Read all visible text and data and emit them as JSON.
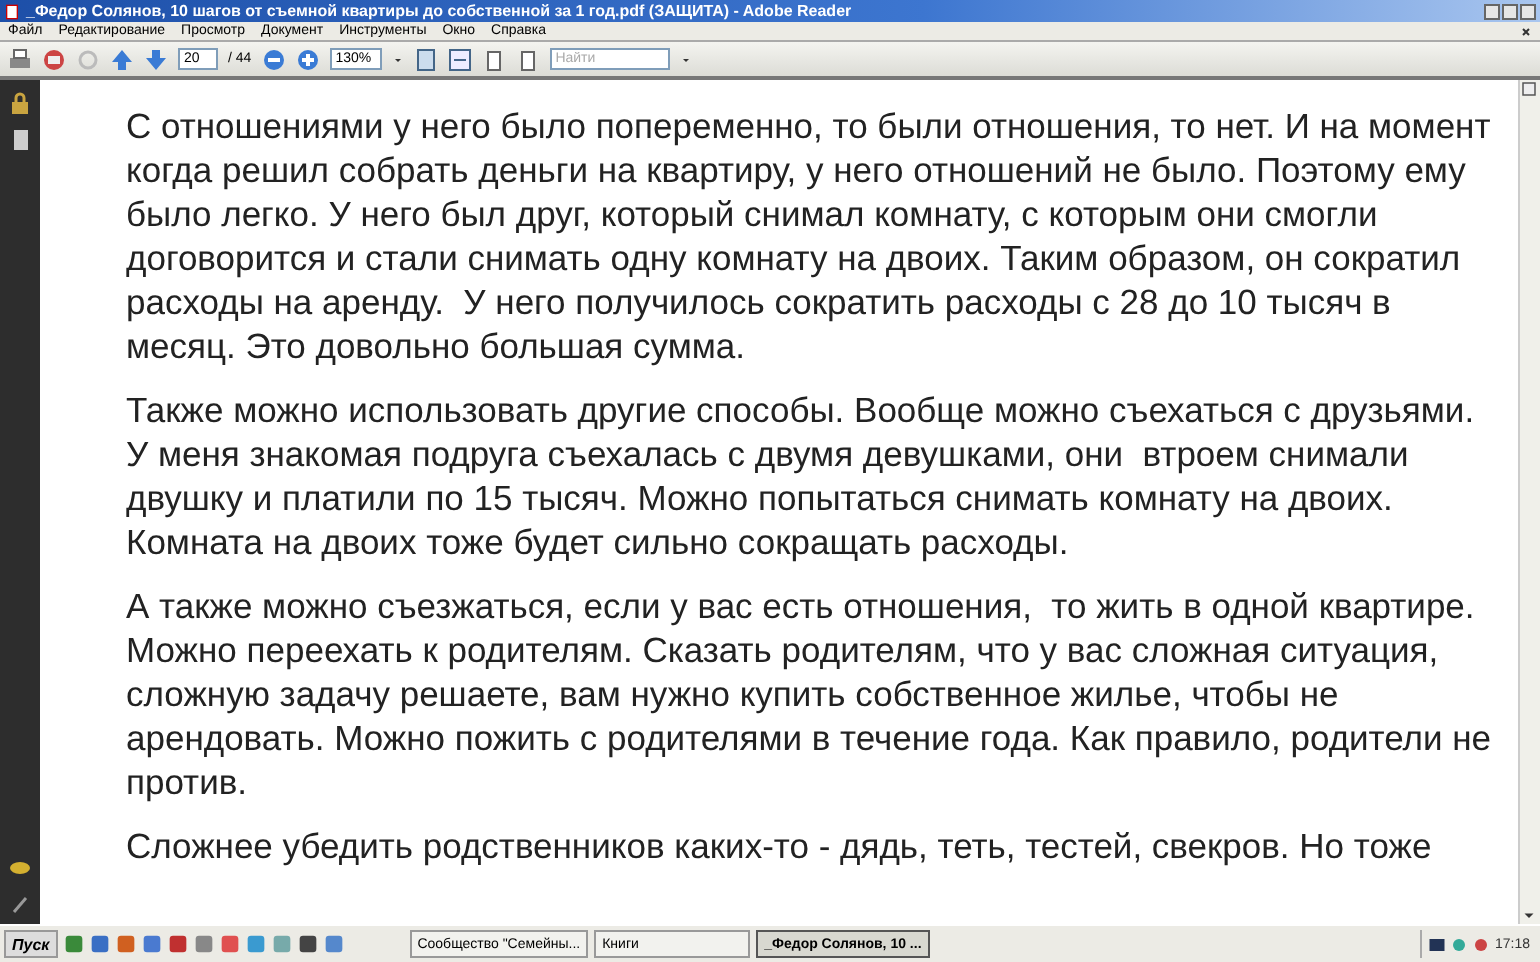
{
  "window": {
    "title": "_Федор Солянов, 10 шагов от съемной квартиры до  собственной за 1 год.pdf (ЗАЩИТА) - Adobe Reader"
  },
  "menu": [
    "Файл",
    "Редактирование",
    "Просмотр",
    "Документ",
    "Инструменты",
    "Окно",
    "Справка"
  ],
  "toolbar": {
    "page": "20",
    "page_count": "/ 44",
    "zoom": "130%",
    "search": {
      "placeholder": "Найти"
    }
  },
  "document": {
    "paragraphs": [
      "С отношениями у него было попеременно, то были отношения, то нет. И на момент\nкогда решил собрать деньги на квартиру, у него отношений не было. Поэтому ему\nбыло легко. У него был друг, который снимал комнату, с которым они смогли\nдоговорится и стали снимать одну комнату на двоих. Таким образом, он сократил\nрасходы на аренду.  У него получилось сократить расходы с 28 до 10 тысяч в\nмесяц. Это довольно большая сумма.",
      "Также можно использовать другие способы. Вообще можно съехаться с друзьями.\nУ меня знакомая подруга съехалась с двумя девушками, они  втроем снимали\nдвушку и платили по 15 тысяч. Можно попытаться снимать комнату на двоих.\nКомната на двоих тоже будет сильно сокращать расходы.",
      "А также можно съезжаться, если у вас есть отношения,  то жить в одной квартире.\nМожно переехать к родителям. Сказать родителям, что у вас сложная ситуация,\nсложную задачу решаете, вам нужно купить собственное жилье, чтобы не\nарендовать. Можно пожить с родителями в течение года. Как правило, родители не\nпротив.",
      "Сложнее убедить родственников каких-то - дядь, теть, тестей, свекров. Но тоже"
    ]
  },
  "taskbar": {
    "start": "Пуск",
    "windows": [
      {
        "label": "Сообщество \"Семейны...",
        "selected": false
      },
      {
        "label": "Книги",
        "selected": false
      },
      {
        "label": "_Федор Солянов, 10 ...",
        "selected": true
      }
    ],
    "clock": "17:18"
  }
}
